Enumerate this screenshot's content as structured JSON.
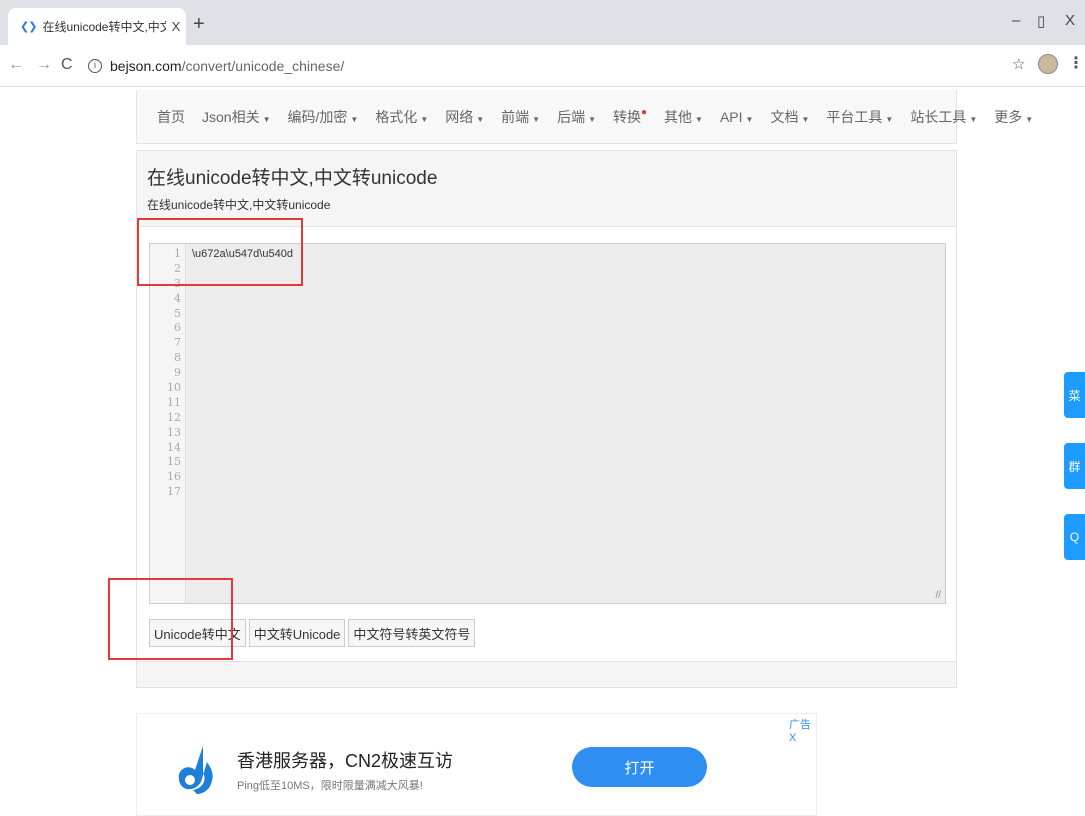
{
  "browser": {
    "tab_title": "在线unicode转中文,中文转unicc",
    "tab_close": "X",
    "new_tab": "+",
    "url_host": "bejson.com",
    "url_path": "/convert/unicode_chinese/",
    "minimize": "–",
    "restore": "▯",
    "close": "X"
  },
  "nav": {
    "items": [
      {
        "label": "首页",
        "caret": false
      },
      {
        "label": "Json相关",
        "caret": true
      },
      {
        "label": "编码/加密",
        "caret": true
      },
      {
        "label": "格式化",
        "caret": true
      },
      {
        "label": "网络",
        "caret": true
      },
      {
        "label": "前端",
        "caret": true
      },
      {
        "label": "后端",
        "caret": true
      },
      {
        "label": "转换",
        "caret": false,
        "hot": true
      },
      {
        "label": "其他",
        "caret": true
      },
      {
        "label": "API",
        "caret": true
      },
      {
        "label": "文档",
        "caret": true
      },
      {
        "label": "平台工具",
        "caret": true
      },
      {
        "label": "站长工具",
        "caret": true
      },
      {
        "label": "更多",
        "caret": true
      }
    ]
  },
  "panel": {
    "title": "在线unicode转中文,中文转unicode",
    "subtitle": "在线unicode转中文,中文转unicode"
  },
  "editor": {
    "line_count": 17,
    "content": "\\u672a\\u547d\\u540d"
  },
  "buttons": {
    "unicode_to_chinese": "Unicode转中文",
    "chinese_to_unicode": "中文转Unicode",
    "cn_symbol_to_en": "中文符号转英文符号"
  },
  "ad": {
    "title": "香港服务器，CN2极速互访",
    "subtitle": "Ping低至10MS，限时限量满减大风暴!",
    "open_button": "打开",
    "tag": "广告X"
  },
  "side_tabs": [
    "菜",
    "群",
    "Q"
  ],
  "colors": {
    "accent": "#2f8ff0",
    "highlight": "#e53935",
    "side_tab": "#1e9bff"
  }
}
